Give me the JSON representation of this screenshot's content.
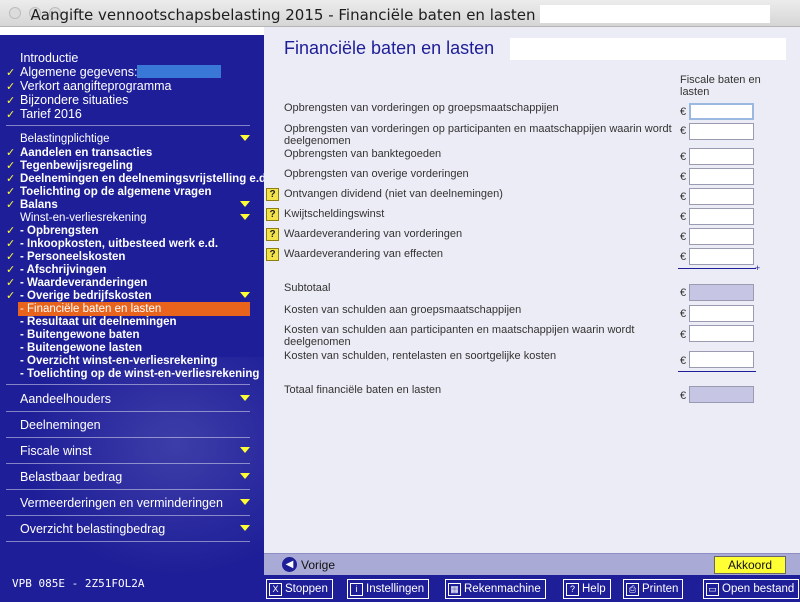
{
  "window": {
    "title": "Aangifte vennootschapsbelasting 2015 - Financiële baten en lasten"
  },
  "sidebar": {
    "items": [
      {
        "label": "Introductie",
        "check": false
      },
      {
        "label": "Algemene gegevens:",
        "check": true
      },
      {
        "label": "Verkort aangifteprogramma",
        "check": true
      },
      {
        "label": "Bijzondere situaties",
        "check": true
      },
      {
        "label": "Tarief 2016",
        "check": true
      },
      {
        "label": "Belastingplichtige",
        "check": false
      },
      {
        "label": "Aandelen en transacties",
        "check": true
      },
      {
        "label": "Tegenbewijsregeling",
        "check": true
      },
      {
        "label": "Deelnemingen en deelnemingsvrijstelling e.d.",
        "check": true
      },
      {
        "label": "Toelichting op de algemene vragen",
        "check": true
      },
      {
        "label": "Balans",
        "check": true
      },
      {
        "label": "Winst-en-verliesrekening",
        "check": false
      },
      {
        "label": "- Opbrengsten",
        "check": true
      },
      {
        "label": "- Inkoopkosten, uitbesteed werk e.d.",
        "check": true
      },
      {
        "label": "- Personeelskosten",
        "check": true
      },
      {
        "label": "- Afschrijvingen",
        "check": true
      },
      {
        "label": "- Waardeveranderingen",
        "check": true
      },
      {
        "label": "- Overige bedrijfskosten",
        "check": true
      },
      {
        "label": "- Financiële baten en lasten",
        "check": false
      },
      {
        "label": "- Resultaat uit deelnemingen",
        "check": false
      },
      {
        "label": "- Buitengewone baten",
        "check": false
      },
      {
        "label": "- Buitengewone lasten",
        "check": false
      },
      {
        "label": "- Overzicht winst-en-verliesrekening",
        "check": false
      },
      {
        "label": "- Toelichting op de winst-en-verliesrekening",
        "check": false
      },
      {
        "label": "Aandeelhouders",
        "check": false
      },
      {
        "label": "Deelnemingen",
        "check": false
      },
      {
        "label": "Fiscale winst",
        "check": false
      },
      {
        "label": "Belastbaar bedrag",
        "check": false
      },
      {
        "label": "Vermeerderingen en verminderingen",
        "check": false
      },
      {
        "label": "Overzicht belastingbedrag",
        "check": false
      }
    ],
    "footer": "VPB 085E - 2Z51FOL2A"
  },
  "main": {
    "title": "Financiële baten en lasten",
    "column_header": "Fiscale baten en lasten",
    "currency": "€",
    "rows": [
      {
        "label": "Opbrengsten van vorderingen op groepsmaatschappijen",
        "value": ""
      },
      {
        "label": "Opbrengsten van vorderingen op participanten en maatschappijen waarin wordt deelgenomen",
        "value": ""
      },
      {
        "label": "Opbrengsten van banktegoeden",
        "value": ""
      },
      {
        "label": "Opbrengsten van overige vorderingen",
        "value": ""
      },
      {
        "label": "Ontvangen dividend (niet van deelnemingen)",
        "value": ""
      },
      {
        "label": "Kwijtscheldingswinst",
        "value": ""
      },
      {
        "label": "Waardeverandering van vorderingen",
        "value": ""
      },
      {
        "label": "Waardeverandering van effecten",
        "value": ""
      },
      {
        "label": "Subtotaal",
        "value": ""
      },
      {
        "label": "Kosten van schulden aan groepsmaatschappijen",
        "value": ""
      },
      {
        "label": "Kosten van schulden aan participanten en maatschappijen waarin wordt deelgenomen",
        "value": ""
      },
      {
        "label": "Kosten van schulden, rentelasten en soortgelijke kosten",
        "value": ""
      },
      {
        "label": "Totaal financiële baten en lasten",
        "value": ""
      }
    ],
    "help_glyph": "?",
    "sum_plus": "+"
  },
  "nav": {
    "previous": "Vorige",
    "accept": "Akkoord"
  },
  "toolbar": {
    "buttons": [
      {
        "label": "Stoppen",
        "icon": "close-box-icon",
        "glyph": "X"
      },
      {
        "label": "Instellingen",
        "icon": "info-box-icon",
        "glyph": "i"
      },
      {
        "label": "Rekenmachine",
        "icon": "calculator-icon",
        "glyph": "▦"
      },
      {
        "label": "Help",
        "icon": "help-box-icon",
        "glyph": "?"
      },
      {
        "label": "Printen",
        "icon": "printer-icon",
        "glyph": "⎙"
      },
      {
        "label": "Open bestand",
        "icon": "folder-icon",
        "glyph": "▭"
      }
    ]
  }
}
